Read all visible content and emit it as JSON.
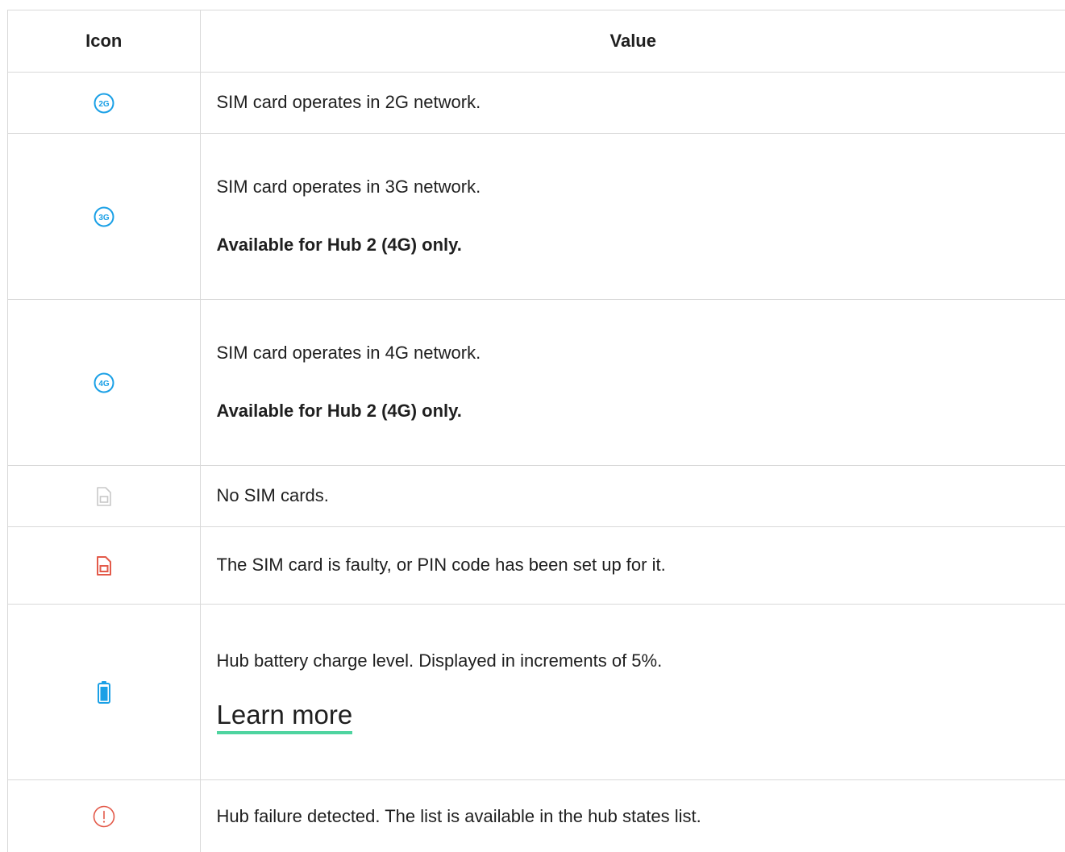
{
  "table": {
    "headers": {
      "icon": "Icon",
      "value": "Value"
    },
    "rows": [
      {
        "icon_name": "2g-icon",
        "icon_text": "2G",
        "icon_color": "#1aa0e6",
        "text": "SIM card operates in 2G network."
      },
      {
        "icon_name": "3g-icon",
        "icon_text": "3G",
        "icon_color": "#1aa0e6",
        "text": "SIM card operates in 3G network.",
        "note": "Available for Hub 2 (4G) only."
      },
      {
        "icon_name": "4g-icon",
        "icon_text": "4G",
        "icon_color": "#1aa0e6",
        "text": "SIM card operates in 4G network.",
        "note": "Available for Hub 2 (4G) only."
      },
      {
        "icon_name": "no-sim-icon",
        "icon_color": "#c8c8c8",
        "text": "No SIM cards."
      },
      {
        "icon_name": "sim-faulty-icon",
        "icon_color": "#e35a4a",
        "text": "The SIM card is faulty, or PIN code has been set up for it."
      },
      {
        "icon_name": "battery-icon",
        "icon_color": "#1aa0e6",
        "text": "Hub battery charge level. Displayed in increments of 5%.",
        "link": "Learn more"
      },
      {
        "icon_name": "failure-icon",
        "icon_color": "#e35a4a",
        "text": "Hub failure detected. The list is available in the hub states list."
      }
    ]
  },
  "colors": {
    "border": "#d9d9d9",
    "link_underline": "#4fd4a0",
    "network_blue": "#1aa0e6",
    "alert_red": "#e35a4a",
    "inactive_grey": "#c8c8c8"
  }
}
